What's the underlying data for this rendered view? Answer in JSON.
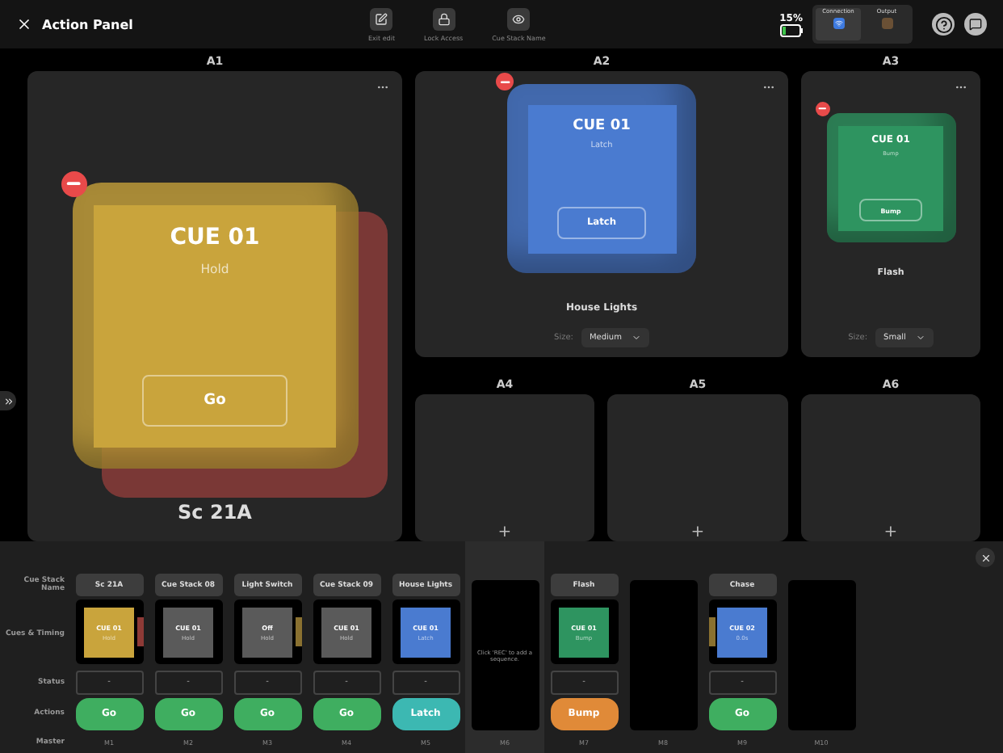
{
  "header": {
    "title": "Action Panel"
  },
  "toolbar": [
    {
      "kind": "edit",
      "label": "Exit edit"
    },
    {
      "kind": "lock",
      "label": "Lock Access"
    },
    {
      "kind": "eye",
      "label": "Cue Stack Name"
    }
  ],
  "battery": {
    "reading": "15%"
  },
  "status_groups": [
    {
      "label": "Connection",
      "active": true
    },
    {
      "label": "Output",
      "active": false
    }
  ],
  "slots": [
    {
      "label": "A1",
      "kind": "large",
      "name": "Sc 21A",
      "stacked_layer": {
        "color": "#8a3c3a"
      },
      "cue": {
        "title": "CUE 01",
        "subtitle": "Hold",
        "button": "Go",
        "color": "#c9a43c"
      }
    },
    {
      "label": "A2",
      "kind": "medium",
      "name": "House Lights",
      "size_label": "Size:",
      "size_value": "Medium",
      "cue": {
        "title": "CUE 01",
        "subtitle": "Latch",
        "button": "Latch",
        "color": "#4a7bd0"
      }
    },
    {
      "label": "A3",
      "kind": "small",
      "name": "Flash",
      "size_label": "Size:",
      "size_value": "Small",
      "cue": {
        "title": "CUE 01",
        "subtitle": "Bump",
        "button": "Bump",
        "color": "#2e9460"
      }
    },
    {
      "label": "A4",
      "kind": "empty",
      "add": "+"
    },
    {
      "label": "A5",
      "kind": "empty",
      "add": "+"
    },
    {
      "label": "A6",
      "kind": "empty",
      "add": "+"
    }
  ],
  "mixer": {
    "row_labels": [
      "Cue Stack Name",
      "Cues & Timing",
      "Status",
      "Actions",
      "Master"
    ],
    "columns": [
      {
        "master": "M1",
        "kind": "stack",
        "selected": false,
        "name": "Sc 21A",
        "cue": {
          "title": "CUE 01",
          "subtitle": "Hold",
          "color": "#c9a43c"
        },
        "side_bar": {
          "kind": "right",
          "color": "#8e3a36"
        },
        "status": "-",
        "action": {
          "label": "Go",
          "color": "#3fae60"
        }
      },
      {
        "master": "M2",
        "kind": "stack",
        "selected": false,
        "name": "Cue Stack 08",
        "cue": {
          "title": "CUE 01",
          "subtitle": "Hold",
          "color": "#5a5a5a"
        },
        "status": "-",
        "action": {
          "label": "Go",
          "color": "#3fae60"
        }
      },
      {
        "master": "M3",
        "kind": "stack",
        "selected": false,
        "name": "Light Switch",
        "cue": {
          "title": "Off",
          "subtitle": "Hold",
          "color": "#5a5a5a"
        },
        "side_bar": {
          "kind": "right",
          "color": "#8a7130"
        },
        "status": "-",
        "action": {
          "label": "Go",
          "color": "#3fae60"
        }
      },
      {
        "master": "M4",
        "kind": "stack",
        "selected": false,
        "name": "Cue Stack 09",
        "cue": {
          "title": "CUE 01",
          "subtitle": "Hold",
          "color": "#5a5a5a"
        },
        "status": "-",
        "action": {
          "label": "Go",
          "color": "#3fae60"
        }
      },
      {
        "master": "M5",
        "kind": "stack",
        "selected": false,
        "name": "House Lights",
        "cue": {
          "title": "CUE 01",
          "subtitle": "Latch",
          "color": "#4a7bd0"
        },
        "status": "-",
        "action": {
          "label": "Latch",
          "color": "#3cb8b2"
        }
      },
      {
        "master": "M6",
        "kind": "empty",
        "selected": true,
        "hint": "Click 'REC' to add a sequence."
      },
      {
        "master": "M7",
        "kind": "stack",
        "selected": false,
        "name": "Flash",
        "cue": {
          "title": "CUE 01",
          "subtitle": "Bump",
          "color": "#2e9460"
        },
        "status": "-",
        "action": {
          "label": "Bump",
          "color": "#e08a38"
        }
      },
      {
        "master": "M8",
        "kind": "empty",
        "selected": false
      },
      {
        "master": "M9",
        "kind": "stack",
        "selected": false,
        "name": "Chase",
        "cue": {
          "title": "CUE 02",
          "subtitle": "0.0s",
          "color": "#4a7bd0"
        },
        "side_bar": {
          "kind": "left",
          "color": "#8a7130"
        },
        "status": "-",
        "action": {
          "label": "Go",
          "color": "#3fae60"
        }
      },
      {
        "master": "M10",
        "kind": "empty",
        "selected": false
      }
    ]
  }
}
